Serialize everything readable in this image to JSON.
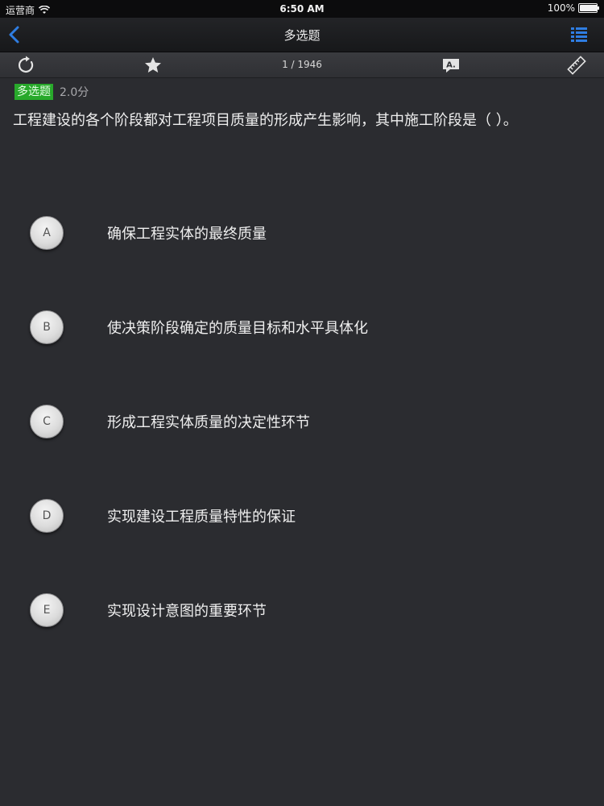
{
  "status_bar": {
    "carrier": "运营商",
    "time": "6:50 AM",
    "battery": "100%",
    "battery_level": 1.0
  },
  "nav_bar": {
    "title": "多选题",
    "back_icon": "chevron-left-icon",
    "menu_icon": "grid-list-icon",
    "accent": "#2f7de1"
  },
  "toolbar": {
    "progress": "1 / 1946",
    "icons": [
      "refresh-icon",
      "star-icon",
      "answer-icon",
      "ruler-icon"
    ]
  },
  "question": {
    "type_label": "多选题",
    "score": "2.0分",
    "text": "工程建设的各个阶段都对工程项目质量的形成产生影响，其中施工阶段是（   ）。",
    "badge_color": "#28a92b"
  },
  "options": [
    {
      "letter": "A",
      "text": "确保工程实体的最终质量"
    },
    {
      "letter": "B",
      "text": "使决策阶段确定的质量目标和水平具体化"
    },
    {
      "letter": "C",
      "text": "形成工程实体质量的决定性环节"
    },
    {
      "letter": "D",
      "text": "实现建设工程质量特性的保证"
    },
    {
      "letter": "E",
      "text": "实现设计意图的重要环节"
    }
  ]
}
